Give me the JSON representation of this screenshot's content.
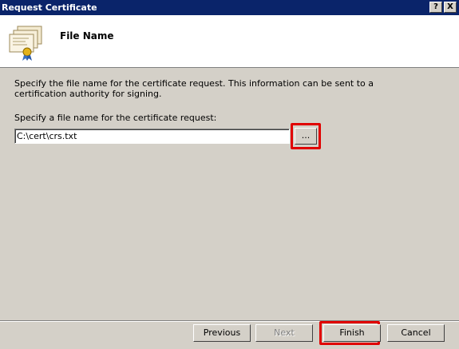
{
  "window": {
    "title": "Request Certificate",
    "help_label": "?",
    "close_label": "X"
  },
  "header": {
    "page_title": "File Name",
    "icon": "certificate-icon"
  },
  "content": {
    "description": "Specify the file name for the certificate request. This information can be sent to a certification authority for signing.",
    "field_label": "Specify a file name for the certificate request:",
    "file_value": "C:\\cert\\crs.txt",
    "browse_label": "..."
  },
  "buttons": {
    "previous": "Previous",
    "next": "Next",
    "finish": "Finish",
    "cancel": "Cancel"
  },
  "colors": {
    "titlebar": "#0a246a",
    "highlight": "#e00000",
    "face": "#d4d0c8"
  }
}
